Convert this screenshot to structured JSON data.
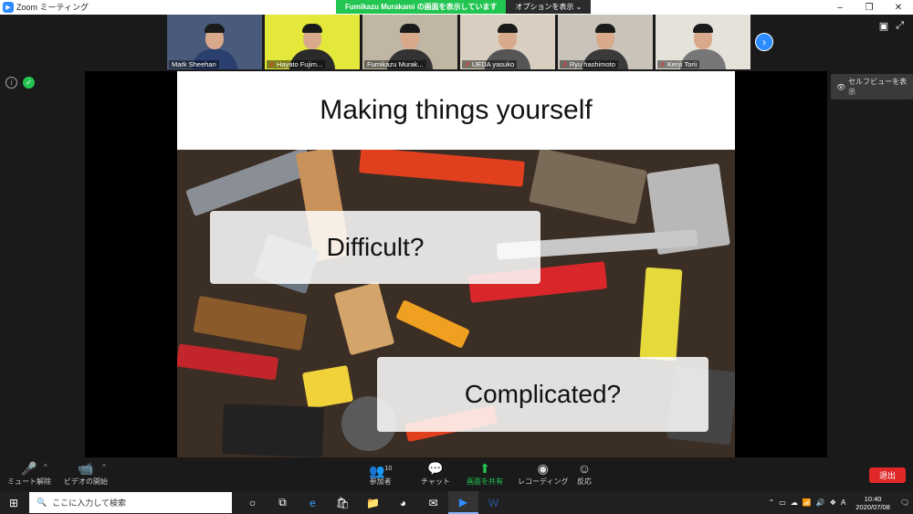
{
  "window": {
    "title": "Zoom ミーティング",
    "controls": [
      "–",
      "❐",
      "✕"
    ]
  },
  "share_banner": {
    "presenter": "Fumikazu Murakami の画面を表示しています",
    "options_label": "オプションを表示 ⌄"
  },
  "participants": [
    {
      "name": "Mark Sheehan",
      "muted": false,
      "bg": "#4a5a7a",
      "shirt": "#2a3f6e"
    },
    {
      "name": "Hayato Fujim...",
      "muted": true,
      "bg": "#e3e83a",
      "shirt": "#2a2a2a"
    },
    {
      "name": "Fumikazu Murak...",
      "muted": false,
      "bg": "#bfb6a4",
      "shirt": "#333"
    },
    {
      "name": "UEDA yasuko",
      "muted": true,
      "bg": "#d8cfc0",
      "shirt": "#555"
    },
    {
      "name": "Ryu hashimoto",
      "muted": true,
      "bg": "#c9c3ba",
      "shirt": "#3a3a3a"
    },
    {
      "name": "Kenji Torii",
      "muted": true,
      "bg": "#e5e2da",
      "shirt": "#777"
    }
  ],
  "self_view_label": "セルフビューを表示",
  "slide": {
    "title": "Making things yourself",
    "callout1": "Difficult?",
    "callout2": "Complicated?"
  },
  "toolbar": {
    "unmute": "ミュート解除",
    "start_video": "ビデオの開始",
    "participants": "参加者",
    "participants_count": "10",
    "chat": "チャット",
    "share": "画面を共有",
    "record": "レコーディング",
    "reactions": "反応",
    "leave": "退出"
  },
  "taskbar": {
    "search_placeholder": "ここに入力して検索",
    "time": "10:40",
    "date": "2020/07/08",
    "ime": "A"
  }
}
